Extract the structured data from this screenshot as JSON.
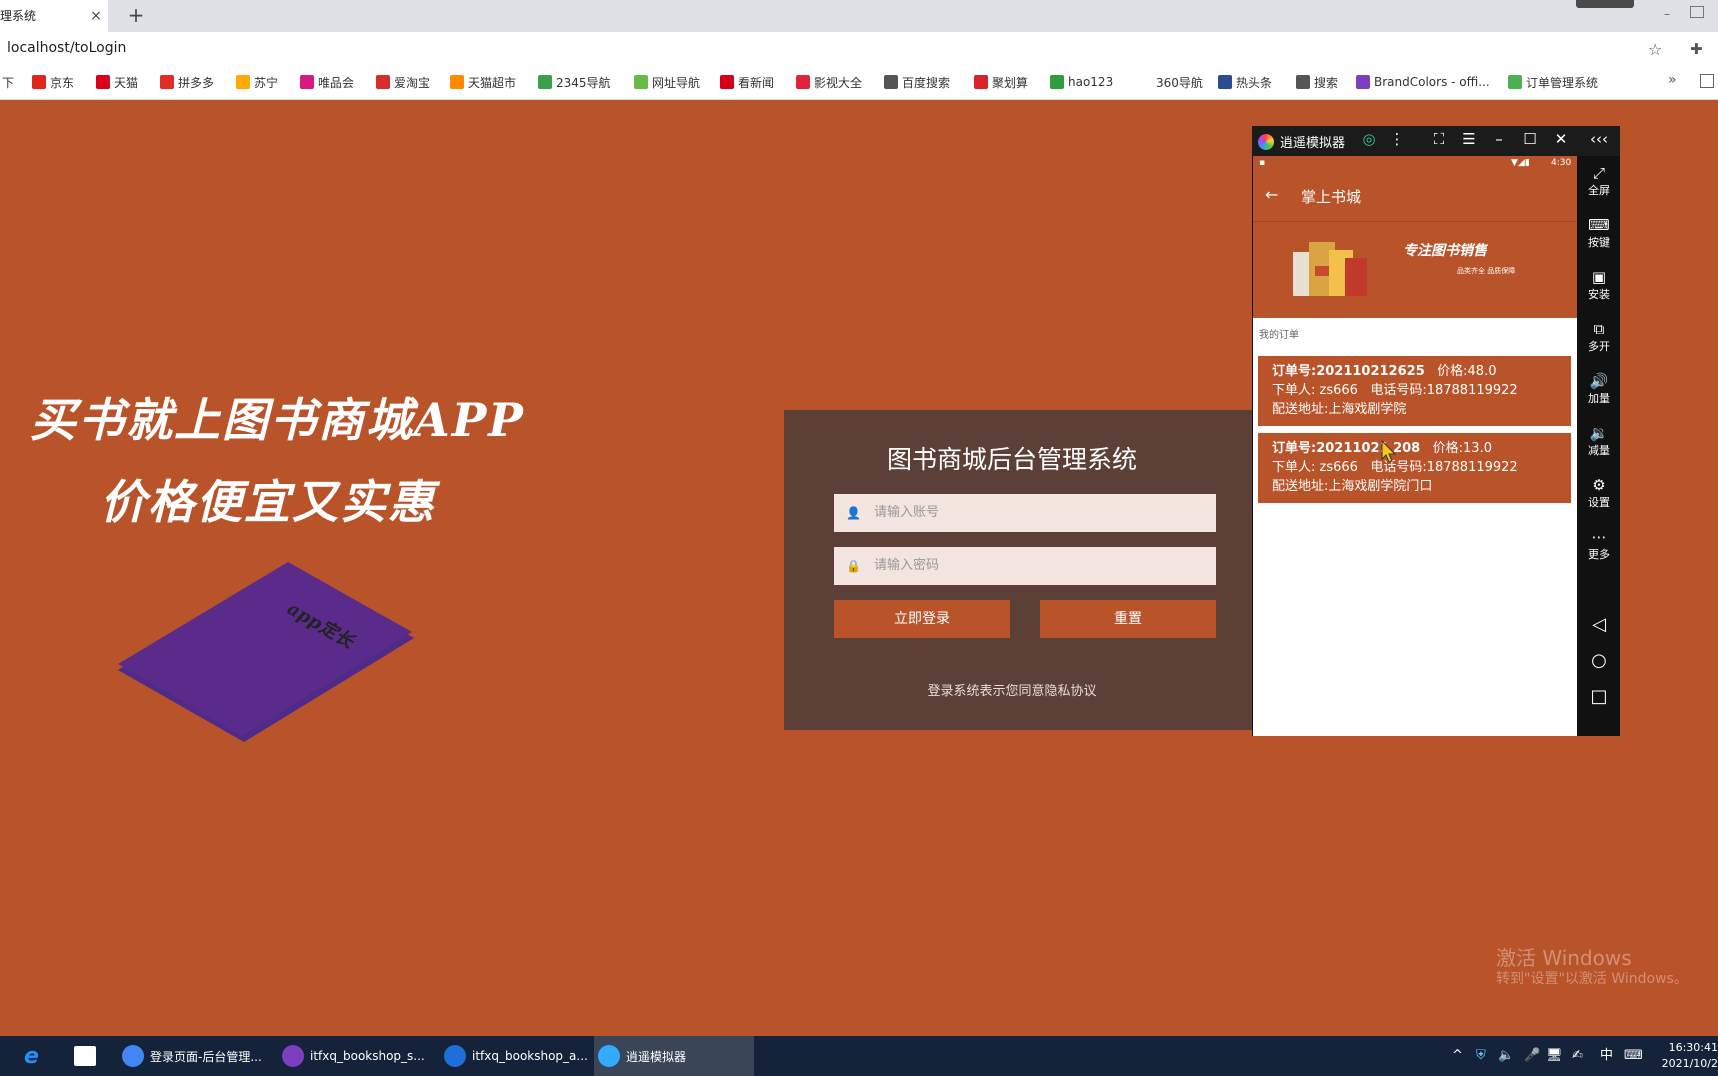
{
  "browser": {
    "tab_title": "理系统",
    "tab_close": "×",
    "tab_new": "+",
    "minimize": "–",
    "url": "localhost/toLogin",
    "star": "☆",
    "ext": "✚",
    "bookmarks": [
      {
        "label": "下",
        "color": "#ffffff"
      },
      {
        "label": "京东",
        "color": "#e1251b"
      },
      {
        "label": "天猫",
        "color": "#d9001b"
      },
      {
        "label": "拼多多",
        "color": "#e02e24"
      },
      {
        "label": "苏宁",
        "color": "#ffaa00"
      },
      {
        "label": "唯品会",
        "color": "#d61a7f"
      },
      {
        "label": "爱淘宝",
        "color": "#d92d2d"
      },
      {
        "label": "天猫超市",
        "color": "#ff8a00"
      },
      {
        "label": "2345导航",
        "color": "#3aa04a"
      },
      {
        "label": "网址导航",
        "color": "#66bb44"
      },
      {
        "label": "看新闻",
        "color": "#d4001b"
      },
      {
        "label": "影视大全",
        "color": "#e0243a"
      },
      {
        "label": "百度搜索",
        "color": "#555555"
      },
      {
        "label": "聚划算",
        "color": "#d9232d"
      },
      {
        "label": "hao123",
        "color": "#2e9e3c"
      },
      {
        "label": "360导航",
        "color": "#ffffff"
      },
      {
        "label": "热头条",
        "color": "#2a4d8f"
      },
      {
        "label": "搜索",
        "color": "#555555"
      },
      {
        "label": "BrandColors - offi...",
        "color": "#7b3fbf"
      },
      {
        "label": "订单管理系统",
        "color": "#4caf50"
      }
    ],
    "more": "»"
  },
  "page": {
    "slogan_line1": "买书就上图书商城APP",
    "slogan_line2": "价格便宜又实惠",
    "book_text": "app定长",
    "login": {
      "title": "图书商城后台管理系统",
      "username_placeholder": "请输入账号",
      "password_placeholder": "请输入密码",
      "login_button": "立即登录",
      "reset_button": "重置",
      "agreement": "登录系统表示您同意隐私协议"
    }
  },
  "emulator": {
    "title": "逍遥模拟器",
    "status_time": "4:30",
    "app_title": "掌上书城",
    "banner_text": "专注图书销售",
    "banner_sub": "品类齐全 品质保障",
    "section_label": "我的订单",
    "orders": [
      {
        "order_line": "订单号:202110212625",
        "price": "价格:48.0",
        "buyer": "下单人:   zs666",
        "phone": "电话号码:18788119922",
        "address": "配送地址:上海戏剧学院"
      },
      {
        "order_line": "订单号:20211021 208",
        "price": "价格:13.0",
        "buyer": "下单人:   zs666",
        "phone": "电话号码:18788119922",
        "address": "配送地址:上海戏剧学院门口"
      }
    ],
    "sidebar": [
      {
        "icon": "⤢",
        "label": "全屏"
      },
      {
        "icon": "⌨",
        "label": "按键"
      },
      {
        "icon": "▣",
        "label": "安装"
      },
      {
        "icon": "⧉",
        "label": "多开"
      },
      {
        "icon": "🔊",
        "label": "加量"
      },
      {
        "icon": "🔉",
        "label": "减量"
      },
      {
        "icon": "⚙",
        "label": "设置"
      },
      {
        "icon": "⋯",
        "label": "更多"
      }
    ]
  },
  "watermark": {
    "line1": "激活 Windows",
    "line2": "转到\"设置\"以激活 Windows。"
  },
  "taskbar": {
    "items": [
      {
        "label": "登录页面-后台管理...",
        "color": "#4285f4"
      },
      {
        "label": "itfxq_bookshop_s...",
        "color": "#7b3fbf"
      },
      {
        "label": "itfxq_bookshop_a...",
        "color": "#1e6fd9"
      },
      {
        "label": "逍遥模拟器",
        "color": "#33aaff"
      }
    ],
    "ime": "中",
    "time": "16:30:41",
    "date": "2021/10/2"
  }
}
